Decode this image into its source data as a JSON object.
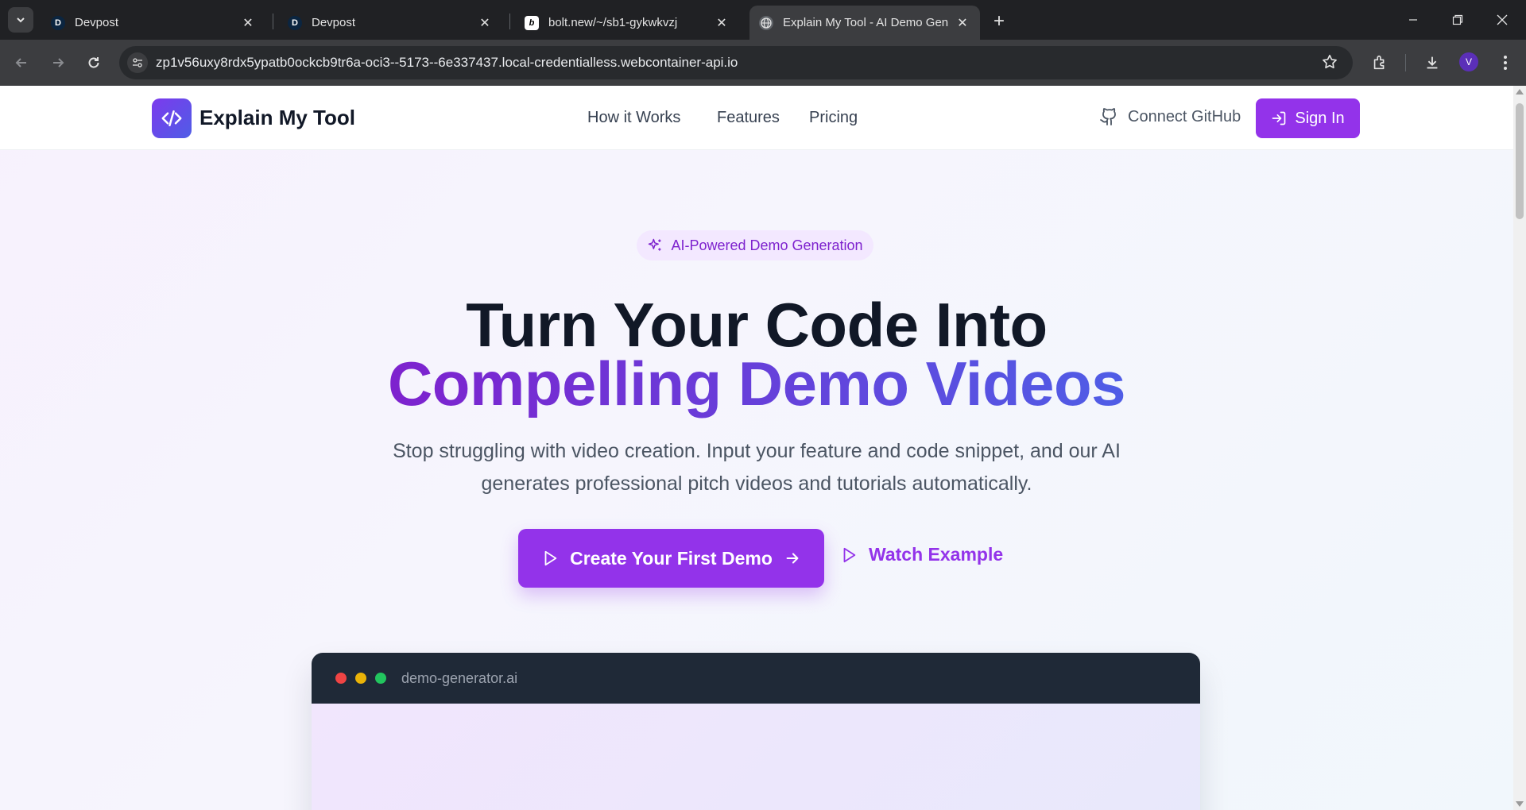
{
  "browser": {
    "tabs": [
      {
        "title": "Devpost",
        "favicon": "D"
      },
      {
        "title": "Devpost",
        "favicon": "D"
      },
      {
        "title": "bolt.new/~/sb1-gykwkvzj",
        "favicon": "b"
      },
      {
        "title": "Explain My Tool - AI Demo Gen",
        "favicon": "globe-icon",
        "active": true
      }
    ],
    "url": "zp1v56uxy8rdx5ypatb0ockcb9tr6a-oci3--5173--6e337437.local-credentialless.webcontainer-api.io",
    "profile_initial": "V"
  },
  "header": {
    "logo_text": "Explain My Tool",
    "nav": [
      "How it Works",
      "Features",
      "Pricing"
    ],
    "connect_github": "Connect GitHub",
    "sign_in": "Sign In"
  },
  "hero": {
    "badge": "AI-Powered Demo Generation",
    "title_line1": "Turn Your Code Into",
    "title_line2": "Compelling Demo Videos",
    "subtitle": "Stop struggling with video creation. Input your feature and code snippet, and our AI generates professional pitch videos and tutorials automatically.",
    "cta_primary": "Create Your First Demo",
    "cta_secondary": "Watch Example"
  },
  "preview_window": {
    "title": "demo-generator.ai"
  },
  "colors": {
    "brand_purple": "#9333ea",
    "brand_indigo": "#4f5de6",
    "dark": "#111827"
  }
}
